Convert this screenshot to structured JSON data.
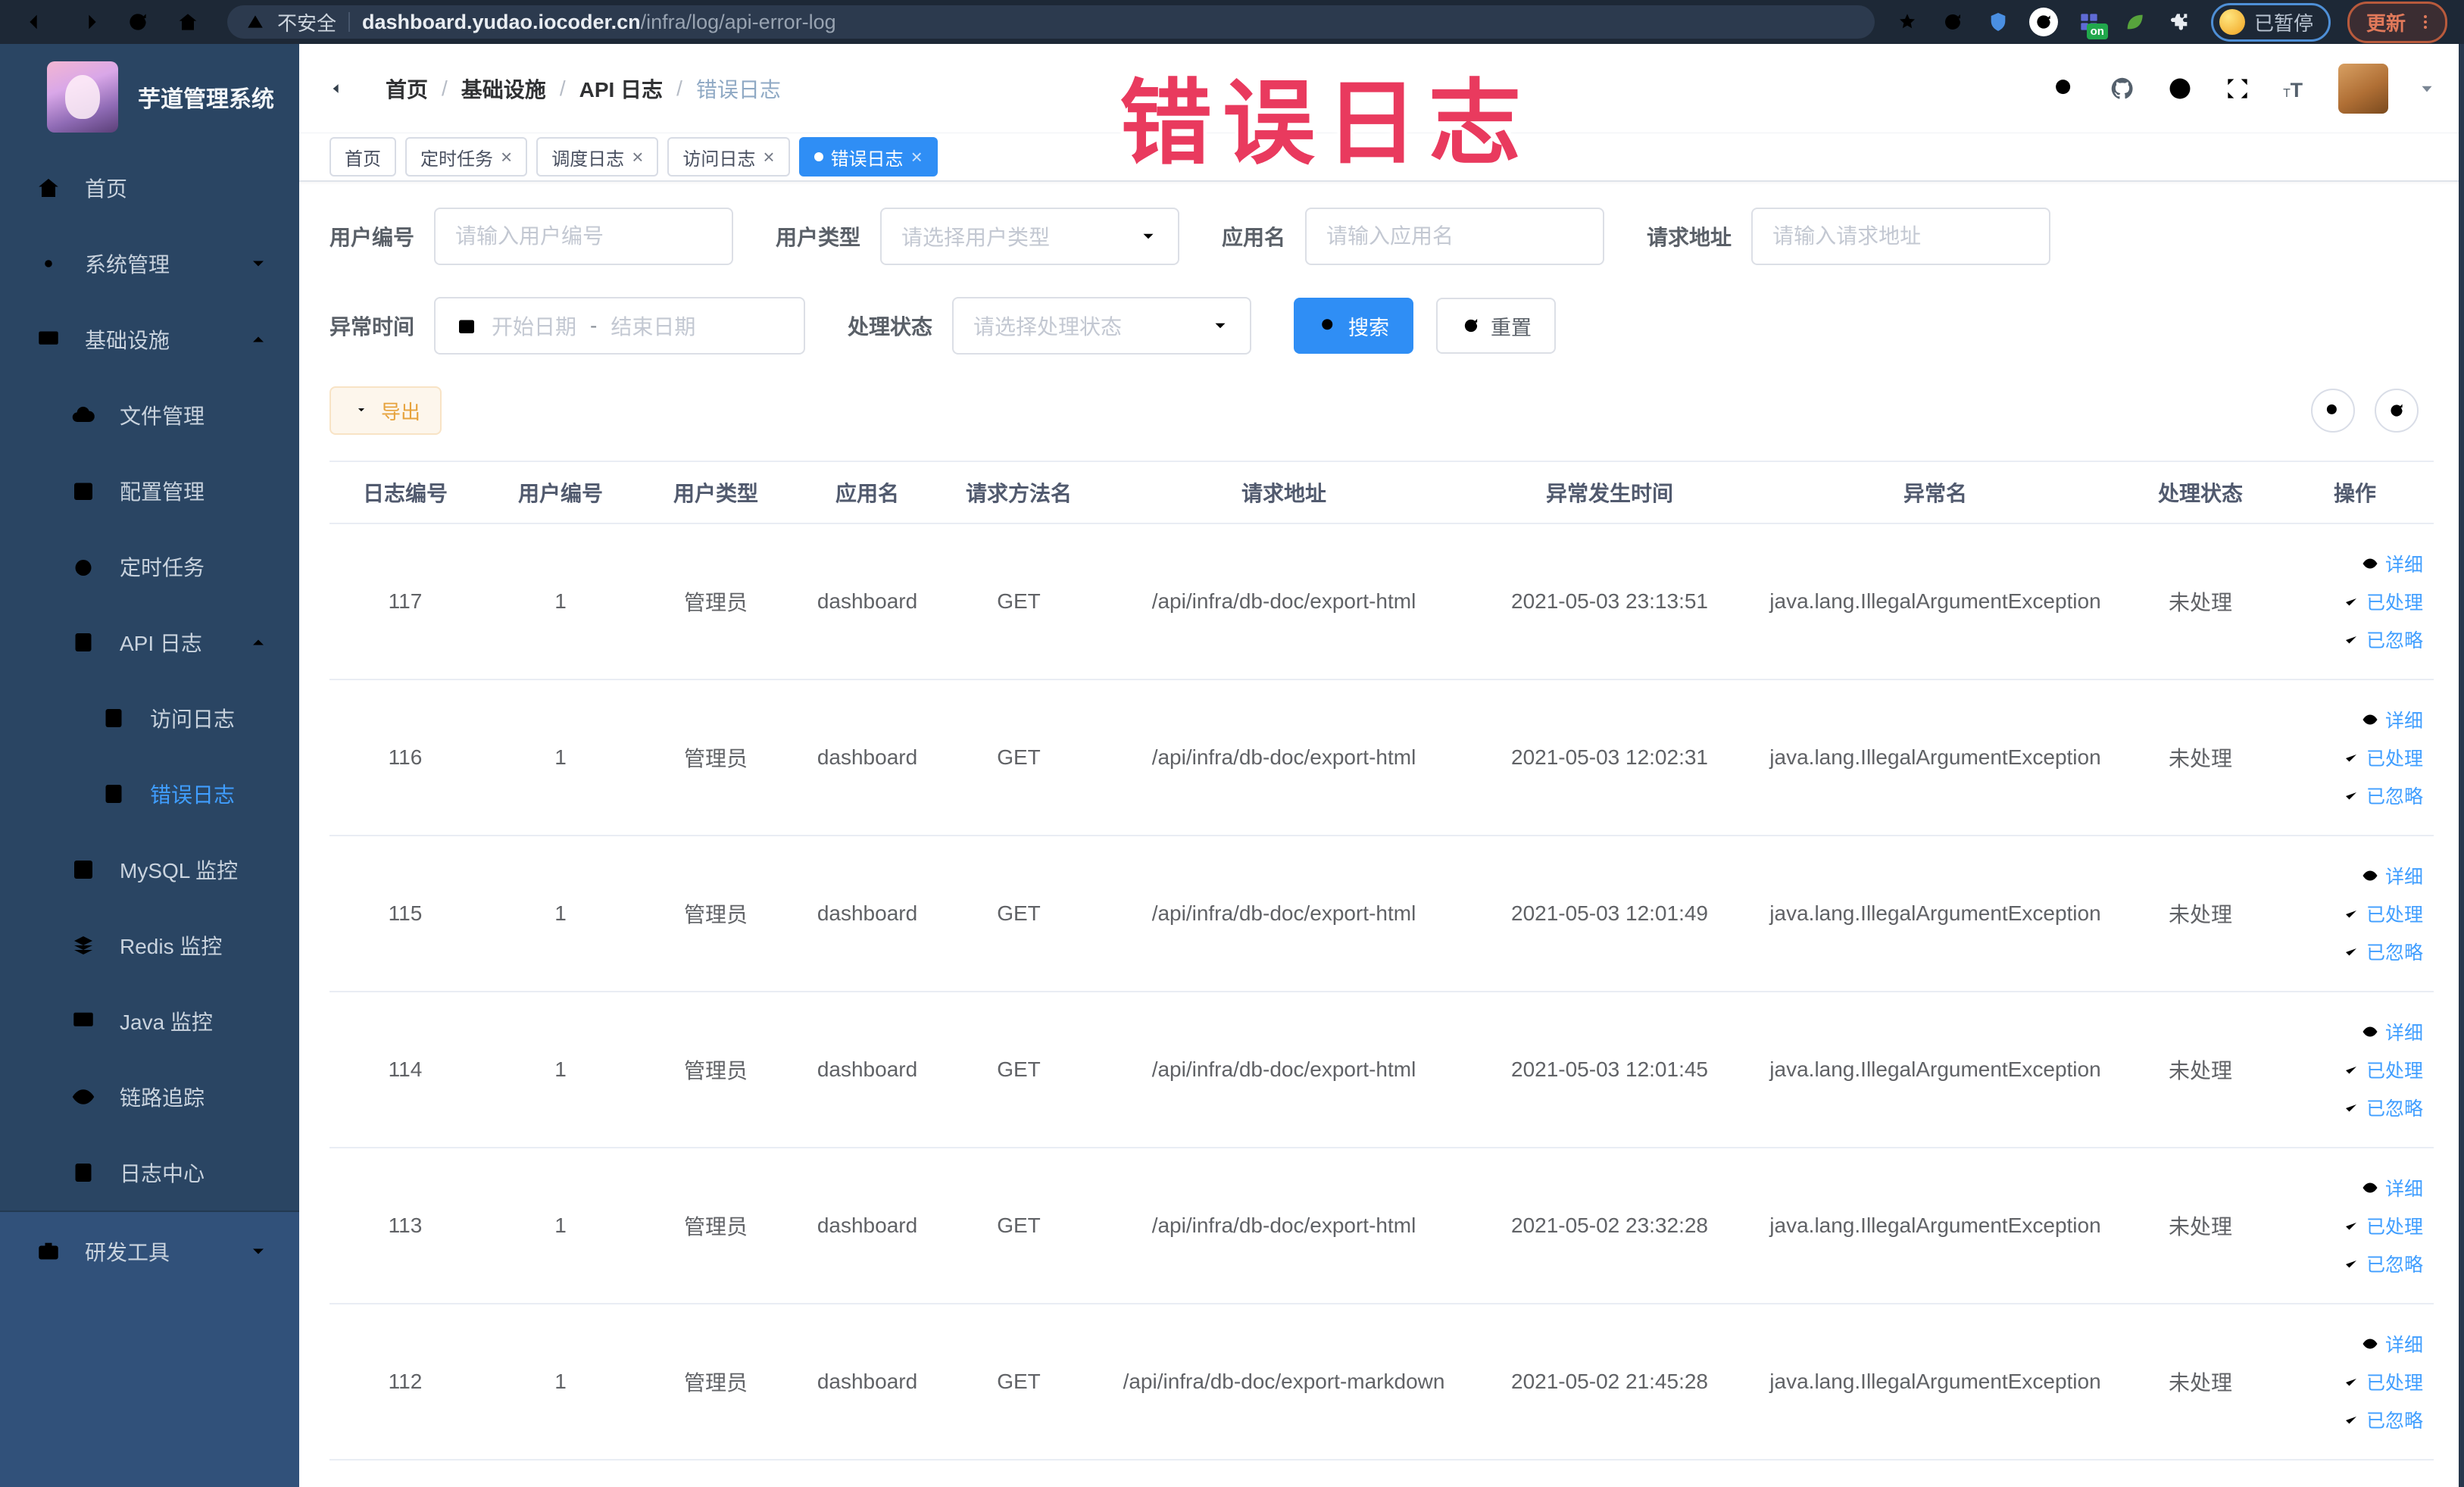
{
  "browser": {
    "security_label": "不安全",
    "url_domain": "dashboard.yudao.iocoder.cn",
    "url_path": "/infra/log/api-error-log",
    "extension_badge_on": "on",
    "paused_badge_label": "已暂停",
    "update_button_label": "更新"
  },
  "overlay_title": "错误日志",
  "colors": {
    "primary": "#409eff",
    "warning": "#e6a23c",
    "overlay_annotation": "#e93a5e",
    "sidebar_bg": "#2a4563"
  },
  "sidebar": {
    "app_title": "芋道管理系统",
    "items": [
      {
        "key": "home",
        "label": "首页",
        "level": 1,
        "icon": "home"
      },
      {
        "key": "system-management",
        "label": "系统管理",
        "level": 1,
        "icon": "gear",
        "arrow": "down"
      },
      {
        "key": "infrastructure",
        "label": "基础设施",
        "level": 1,
        "icon": "monitor",
        "arrow": "up"
      },
      {
        "key": "file-management",
        "label": "文件管理",
        "level": 2,
        "icon": "cloud"
      },
      {
        "key": "config-management",
        "label": "配置管理",
        "level": 2,
        "icon": "edit"
      },
      {
        "key": "scheduled-tasks",
        "label": "定时任务",
        "level": 2,
        "icon": "timer"
      },
      {
        "key": "api-log",
        "label": "API 日志",
        "level": 2,
        "icon": "doc",
        "arrow": "up"
      },
      {
        "key": "access-log",
        "label": "访问日志",
        "level": 3,
        "icon": "doc"
      },
      {
        "key": "error-log",
        "label": "错误日志",
        "level": 3,
        "icon": "doc",
        "active": true
      },
      {
        "key": "mysql-monitor",
        "label": "MySQL 监控",
        "level": 2,
        "icon": "chart"
      },
      {
        "key": "redis-monitor",
        "label": "Redis 监控",
        "level": 2,
        "icon": "layers"
      },
      {
        "key": "java-monitor",
        "label": "Java 监控",
        "level": 2,
        "icon": "screen"
      },
      {
        "key": "trace",
        "label": "链路追踪",
        "level": 2,
        "icon": "eye"
      },
      {
        "key": "log-center",
        "label": "日志中心",
        "level": 2,
        "icon": "doc"
      },
      {
        "key": "dev-tools",
        "label": "研发工具",
        "level": 1,
        "icon": "briefcase",
        "arrow": "down",
        "section": "light"
      }
    ]
  },
  "header": {
    "breadcrumb": [
      "首页",
      "基础设施",
      "API 日志",
      "错误日志"
    ]
  },
  "tabs": [
    {
      "key": "home",
      "label": "首页"
    },
    {
      "key": "scheduled-tasks",
      "label": "定时任务",
      "closable": true
    },
    {
      "key": "schedule-log",
      "label": "调度日志",
      "closable": true
    },
    {
      "key": "access-log",
      "label": "访问日志",
      "closable": true
    },
    {
      "key": "error-log",
      "label": "错误日志",
      "closable": true,
      "active": true
    }
  ],
  "filters": {
    "user_id": {
      "label": "用户编号",
      "placeholder": "请输入用户编号"
    },
    "user_type": {
      "label": "用户类型",
      "placeholder": "请选择用户类型"
    },
    "app_name": {
      "label": "应用名",
      "placeholder": "请输入应用名"
    },
    "request_url": {
      "label": "请求地址",
      "placeholder": "请输入请求地址"
    },
    "exception_time": {
      "label": "异常时间",
      "start_placeholder": "开始日期",
      "separator": "-",
      "end_placeholder": "结束日期"
    },
    "process_status": {
      "label": "处理状态",
      "placeholder": "请选择处理状态"
    },
    "search_button": "搜索",
    "reset_button": "重置"
  },
  "toolbar": {
    "export_label": "导出"
  },
  "table": {
    "columns": [
      "日志编号",
      "用户编号",
      "用户类型",
      "应用名",
      "请求方法名",
      "请求地址",
      "异常发生时间",
      "异常名",
      "处理状态",
      "操作"
    ],
    "action_labels": [
      "详细",
      "已处理",
      "已忽略"
    ],
    "rows": [
      {
        "id": "117",
        "user_id": "1",
        "user_type": "管理员",
        "app": "dashboard",
        "method": "GET",
        "url": "/api/infra/db-doc/export-html",
        "time": "2021-05-03 23:13:51",
        "exception": "java.lang.IllegalArgumentException",
        "status": "未处理"
      },
      {
        "id": "116",
        "user_id": "1",
        "user_type": "管理员",
        "app": "dashboard",
        "method": "GET",
        "url": "/api/infra/db-doc/export-html",
        "time": "2021-05-03 12:02:31",
        "exception": "java.lang.IllegalArgumentException",
        "status": "未处理"
      },
      {
        "id": "115",
        "user_id": "1",
        "user_type": "管理员",
        "app": "dashboard",
        "method": "GET",
        "url": "/api/infra/db-doc/export-html",
        "time": "2021-05-03 12:01:49",
        "exception": "java.lang.IllegalArgumentException",
        "status": "未处理"
      },
      {
        "id": "114",
        "user_id": "1",
        "user_type": "管理员",
        "app": "dashboard",
        "method": "GET",
        "url": "/api/infra/db-doc/export-html",
        "time": "2021-05-03 12:01:45",
        "exception": "java.lang.IllegalArgumentException",
        "status": "未处理"
      },
      {
        "id": "113",
        "user_id": "1",
        "user_type": "管理员",
        "app": "dashboard",
        "method": "GET",
        "url": "/api/infra/db-doc/export-html",
        "time": "2021-05-02 23:32:28",
        "exception": "java.lang.IllegalArgumentException",
        "status": "未处理"
      },
      {
        "id": "112",
        "user_id": "1",
        "user_type": "管理员",
        "app": "dashboard",
        "method": "GET",
        "url": "/api/infra/db-doc/export-markdown",
        "time": "2021-05-02 21:45:28",
        "exception": "java.lang.IllegalArgumentException",
        "status": "未处理"
      }
    ]
  }
}
